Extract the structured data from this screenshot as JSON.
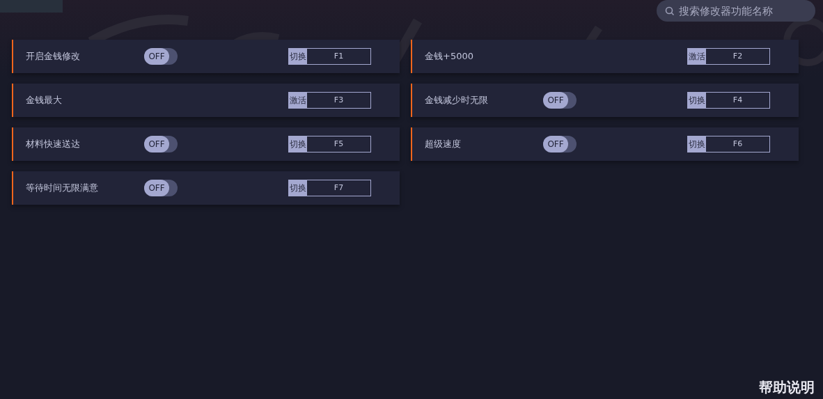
{
  "search": {
    "placeholder": "搜索修改器功能名称"
  },
  "features": [
    {
      "name": "开启金钱修改",
      "kind": "toggle",
      "on": false,
      "state_text": "OFF",
      "action": "切换",
      "hotkey": "F1"
    },
    {
      "name": "金钱+5000",
      "kind": "button",
      "action": "激活",
      "hotkey": "F2"
    },
    {
      "name": "金钱最大",
      "kind": "button",
      "action": "激活",
      "hotkey": "F3"
    },
    {
      "name": "金钱减少时无限",
      "kind": "toggle",
      "on": false,
      "state_text": "OFF",
      "action": "切换",
      "hotkey": "F4"
    },
    {
      "name": "材料快速送达",
      "kind": "toggle",
      "on": false,
      "state_text": "OFF",
      "action": "切换",
      "hotkey": "F5"
    },
    {
      "name": "超级速度",
      "kind": "toggle",
      "on": false,
      "state_text": "OFF",
      "action": "切换",
      "hotkey": "F6"
    },
    {
      "name": "等待时间无限满意",
      "kind": "toggle",
      "on": false,
      "state_text": "OFF",
      "action": "切换",
      "hotkey": "F7"
    }
  ],
  "help_link": "帮助说明"
}
